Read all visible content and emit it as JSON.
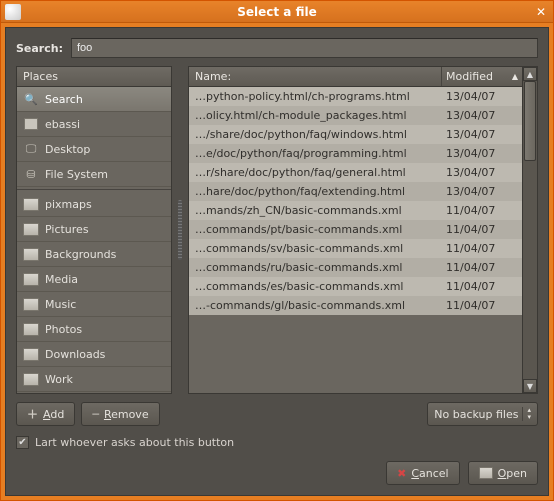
{
  "window": {
    "title": "Select a file"
  },
  "search": {
    "label": "Search:",
    "value": "foo"
  },
  "places": {
    "header": "Places",
    "items": [
      {
        "label": "Search",
        "icon": "search",
        "selected": true
      },
      {
        "label": "ebassi",
        "icon": "home"
      },
      {
        "label": "Desktop",
        "icon": "desktop"
      },
      {
        "label": "File System",
        "icon": "drive"
      },
      {
        "label": "pixmaps",
        "icon": "folder",
        "sep_before": true
      },
      {
        "label": "Pictures",
        "icon": "folder"
      },
      {
        "label": "Backgrounds",
        "icon": "folder"
      },
      {
        "label": "Media",
        "icon": "folder"
      },
      {
        "label": "Music",
        "icon": "folder"
      },
      {
        "label": "Photos",
        "icon": "folder"
      },
      {
        "label": "Downloads",
        "icon": "folder"
      },
      {
        "label": "Work",
        "icon": "folder"
      }
    ]
  },
  "files": {
    "col_name": "Name:",
    "col_modified": "Modified",
    "sort_dir": "asc",
    "rows": [
      {
        "name": "…python-policy.html/ch-programs.html",
        "modified": "13/04/07"
      },
      {
        "name": "…olicy.html/ch-module_packages.html",
        "modified": "13/04/07"
      },
      {
        "name": "…/share/doc/python/faq/windows.html",
        "modified": "13/04/07"
      },
      {
        "name": "…e/doc/python/faq/programming.html",
        "modified": "13/04/07"
      },
      {
        "name": "…r/share/doc/python/faq/general.html",
        "modified": "13/04/07"
      },
      {
        "name": "…hare/doc/python/faq/extending.html",
        "modified": "13/04/07"
      },
      {
        "name": "…mands/zh_CN/basic-commands.xml",
        "modified": "11/04/07"
      },
      {
        "name": "…commands/pt/basic-commands.xml",
        "modified": "11/04/07"
      },
      {
        "name": "…commands/sv/basic-commands.xml",
        "modified": "11/04/07"
      },
      {
        "name": "…commands/ru/basic-commands.xml",
        "modified": "11/04/07"
      },
      {
        "name": "…commands/es/basic-commands.xml",
        "modified": "11/04/07"
      },
      {
        "name": "…-commands/gl/basic-commands.xml",
        "modified": "11/04/07"
      }
    ]
  },
  "buttons": {
    "add": "Add",
    "remove": "Remove",
    "filter": "No backup files",
    "cancel": "Cancel",
    "open": "Open"
  },
  "checkbox": {
    "checked": true,
    "label": "Lart whoever asks about this button"
  }
}
